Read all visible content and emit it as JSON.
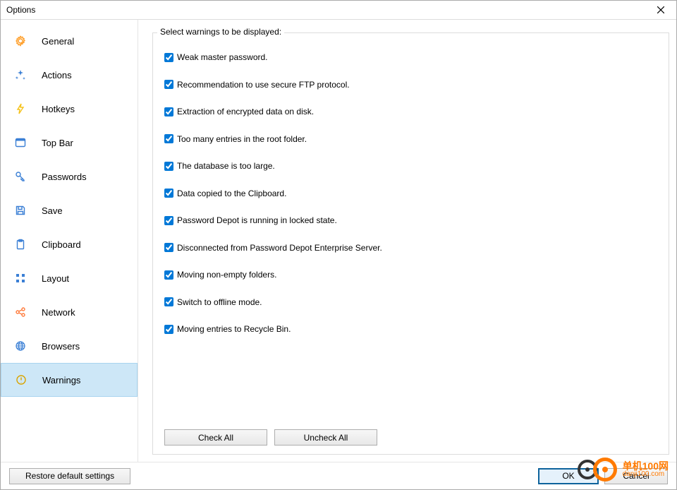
{
  "window": {
    "title": "Options"
  },
  "sidebar": {
    "items": [
      {
        "label": "General"
      },
      {
        "label": "Actions"
      },
      {
        "label": "Hotkeys"
      },
      {
        "label": "Top Bar"
      },
      {
        "label": "Passwords"
      },
      {
        "label": "Save"
      },
      {
        "label": "Clipboard"
      },
      {
        "label": "Layout"
      },
      {
        "label": "Network"
      },
      {
        "label": "Browsers"
      },
      {
        "label": "Warnings",
        "selected": true
      }
    ]
  },
  "content": {
    "group_title": "Select warnings to be displayed:",
    "warnings": [
      {
        "label": "Weak master password.",
        "checked": true
      },
      {
        "label": "Recommendation to use secure FTP protocol.",
        "checked": true
      },
      {
        "label": "Extraction of encrypted data on disk.",
        "checked": true
      },
      {
        "label": "Too many entries in the root folder.",
        "checked": true
      },
      {
        "label": "The database is too large.",
        "checked": true
      },
      {
        "label": "Data copied to the Clipboard.",
        "checked": true
      },
      {
        "label": "Password Depot is running in locked state.",
        "checked": true
      },
      {
        "label": "Disconnected from Password Depot Enterprise Server.",
        "checked": true
      },
      {
        "label": "Moving non-empty folders.",
        "checked": true
      },
      {
        "label": "Switch to offline mode.",
        "checked": true
      },
      {
        "label": "Moving entries to Recycle Bin.",
        "checked": true
      }
    ],
    "check_all": "Check All",
    "uncheck_all": "Uncheck All"
  },
  "footer": {
    "restore_defaults": "Restore default settings",
    "ok": "OK",
    "cancel": "Cancel"
  },
  "watermark": {
    "name": "单机100网",
    "url": "danji100.com"
  }
}
